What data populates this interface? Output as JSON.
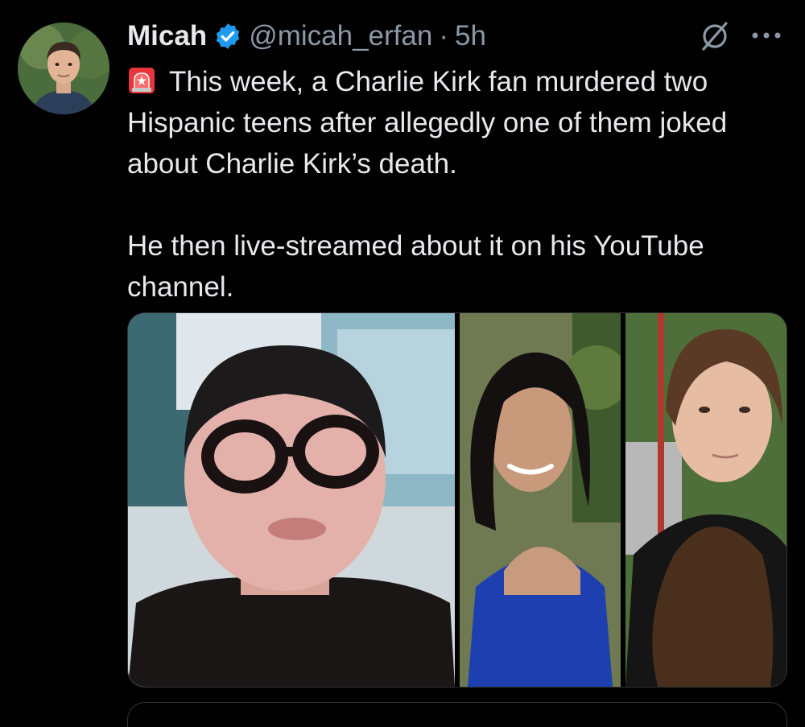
{
  "author": {
    "name": "Micah",
    "handle": "@micah_erfan",
    "separator": "·",
    "time": "5h",
    "verified": true,
    "verified_color": "#1d9bf0"
  },
  "tweet": {
    "lead_icon": "siren-icon",
    "paragraph_1": "This week, a Charlie Kirk fan murdered two Hispanic teens after allegedly one of them joked about Charlie Kirk’s death.",
    "paragraph_2": "He then live-streamed about it on his YouTube channel."
  },
  "actions": {
    "grok_icon": "grok-icon",
    "more_icon": "more-options-icon"
  },
  "media": {
    "count": 3
  },
  "colors": {
    "background": "#000000",
    "text_primary": "#e7e9ea",
    "text_secondary": "#8b98a5",
    "border": "#2f3336"
  }
}
